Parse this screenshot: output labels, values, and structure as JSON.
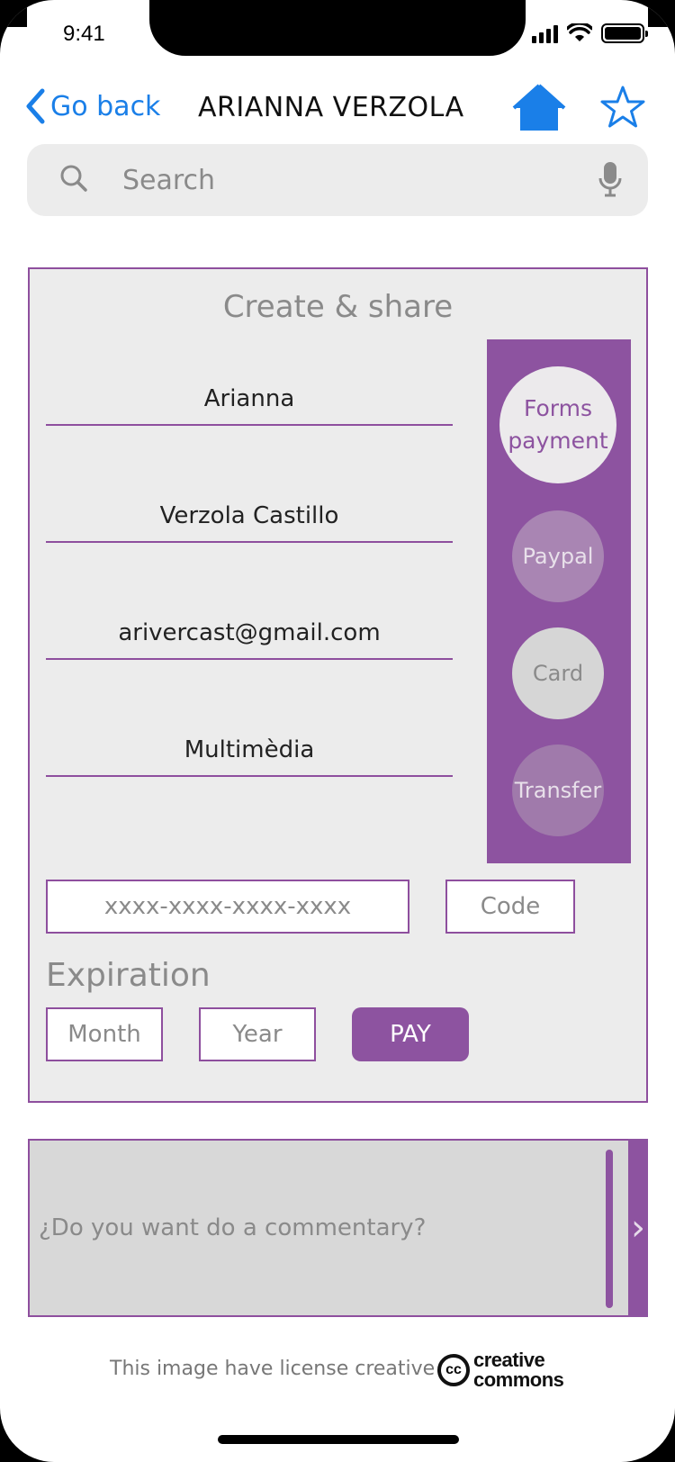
{
  "status_bar": {
    "time": "9:41"
  },
  "nav": {
    "back_label": "Go back",
    "title": "ARIANNA VERZOLA"
  },
  "search": {
    "placeholder": "Search"
  },
  "panel": {
    "title": "Create & share",
    "fields": {
      "first_name": "Arianna",
      "last_name": "Verzola Castillo",
      "email": "arivercast@gmail.com",
      "program": "Multimèdia"
    },
    "payment_methods": {
      "header": "Forms payment",
      "options": [
        "Paypal",
        "Card",
        "Transfer"
      ]
    },
    "card_number_placeholder": "xxxx-xxxx-xxxx-xxxx",
    "code_placeholder": "Code",
    "expiration_label": "Expiration",
    "month_placeholder": "Month",
    "year_placeholder": "Year",
    "pay_label": "PAY"
  },
  "comment": {
    "placeholder": "¿Do you want do a commentary?",
    "button_glyph": "›"
  },
  "footer": {
    "license_text": "This image have license creative",
    "logo_cc": "cc",
    "logo_word1": "creative",
    "logo_word2": "commons"
  },
  "colors": {
    "accent": "#8d53a0",
    "link": "#1a7fe8"
  }
}
